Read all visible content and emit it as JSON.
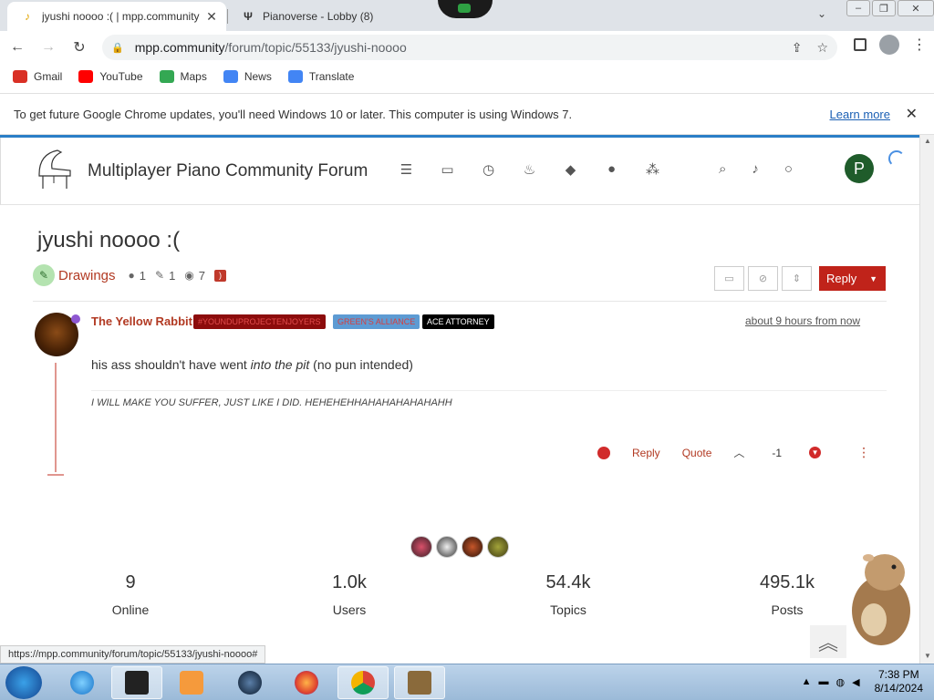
{
  "browser": {
    "tabs": [
      {
        "title": "jyushi noooo :( | mpp.community",
        "close": "✕"
      },
      {
        "title": "Pianoverse - Lobby (8)"
      }
    ],
    "url_host": "mpp.community",
    "url_path": "/forum/topic/55133/jyushi-noooo",
    "bookmarks": [
      {
        "label": "Gmail",
        "color": "#d93025"
      },
      {
        "label": "YouTube",
        "color": "#ff0000"
      },
      {
        "label": "Maps",
        "color": "#34a853"
      },
      {
        "label": "News",
        "color": "#4285f4"
      },
      {
        "label": "Translate",
        "color": "#4285f4"
      }
    ],
    "infobar_text": "To get future Google Chrome updates, you'll need Windows 10 or later. This computer is using Windows 7.",
    "infobar_link": "Learn more",
    "status_url": "https://mpp.community/forum/topic/55133/jyushi-noooo#"
  },
  "forum": {
    "brand": "Multiplayer Piano Community Forum",
    "avatar_letter": "P"
  },
  "topic": {
    "title": "jyushi noooo :(",
    "category": "Drawings",
    "posters": "1",
    "posts": "1",
    "views": "7",
    "reply_label": "Reply"
  },
  "post": {
    "author": "The Yellow Rabbit",
    "badges": [
      "#YOUNDUPROJECTENJOYERS",
      "GREEN'S ALLIANCE",
      "ACE ATTORNEY"
    ],
    "time": "about 9 hours from now",
    "body_before": "his ass shouldn't have went ",
    "body_em": "into the pit",
    "body_after": " (no pun intended)",
    "signature": "I WILL MAKE YOU SUFFER, JUST LIKE I DID. HEHEHEHHAHAHAHAHAHAHH",
    "reply_label": "Reply",
    "quote_label": "Quote",
    "votes": "-1"
  },
  "stats": [
    {
      "num": "9",
      "label": "Online"
    },
    {
      "num": "1.0k",
      "label": "Users"
    },
    {
      "num": "54.4k",
      "label": "Topics"
    },
    {
      "num": "495.1k",
      "label": "Posts"
    }
  ],
  "taskbar": {
    "time": "7:38 PM",
    "date": "8/14/2024"
  }
}
